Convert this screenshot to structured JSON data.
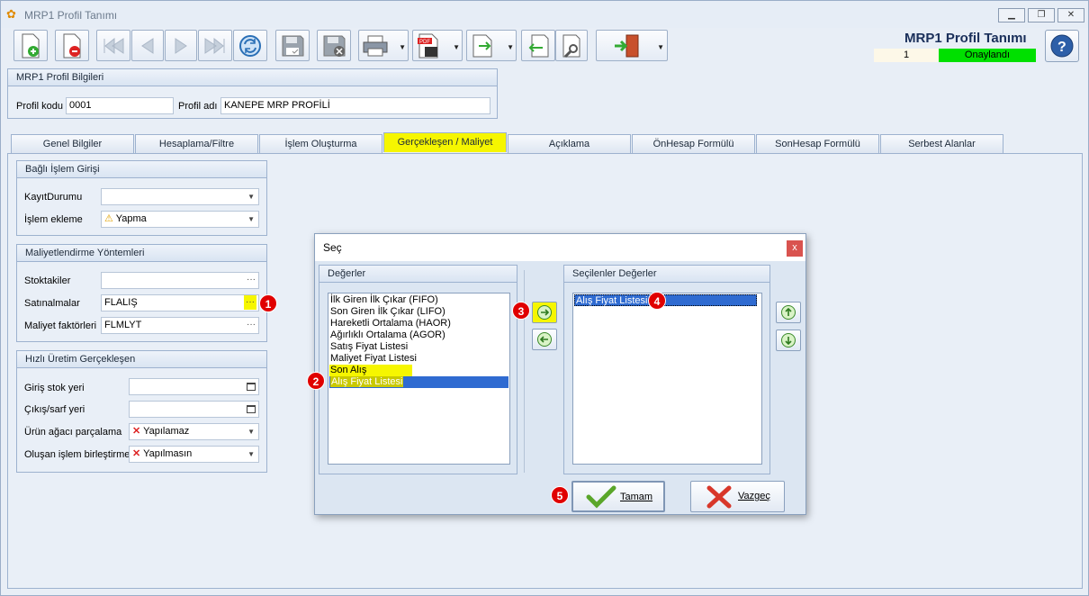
{
  "window": {
    "title": "MRP1 Profil Tanımı",
    "app_icon": "butterfly-icon",
    "controls": [
      "minimize-icon",
      "restore-icon",
      "close-icon"
    ]
  },
  "toolbar": {
    "buttons": [
      "new-doc-icon",
      "delete-doc-icon",
      "first-record-icon",
      "prev-record-icon",
      "next-record-icon",
      "last-record-icon",
      "refresh-icon",
      "save-icon",
      "save-close-icon",
      "print-icon",
      "pdf-icon",
      "export-icon",
      "import-icon",
      "settings-icon",
      "exit-icon"
    ]
  },
  "header": {
    "app_title": "MRP1 Profil Tanımı",
    "row_number": "1",
    "status": "Onaylandı",
    "status_color": "#00e000"
  },
  "profile": {
    "section_title": "MRP1 Profil Bilgileri",
    "code_label": "Profil kodu",
    "code_value": "0001",
    "name_label": "Profil adı",
    "name_value": "KANEPE MRP PROFİLİ"
  },
  "tabs": [
    "Genel Bilgiler",
    "Hesaplama/Filtre",
    "İşlem Oluşturma",
    "Gerçekleşen / Maliyet",
    "Açıklama",
    "ÖnHesap Formülü",
    "SonHesap Formülü",
    "Serbest Alanlar"
  ],
  "active_tab": "Gerçekleşen / Maliyet",
  "bagli": {
    "title": "Bağlı İşlem Girişi",
    "kayit_label": "KayıtDurumu",
    "kayit_value": "",
    "islem_label": "İşlem ekleme",
    "islem_value": "Yapma"
  },
  "maliyet": {
    "title": "Maliyetlendirme Yöntemleri",
    "stok_label": "Stoktakiler",
    "stok_value": "",
    "satin_label": "Satınalmalar",
    "satin_value": "FLALIŞ",
    "faktor_label": "Maliyet faktörleri",
    "faktor_value": "FLMLYT"
  },
  "hizli": {
    "title": "Hızlı Üretim Gerçekleşen",
    "giris_label": "Giriş stok yeri",
    "giris_value": "",
    "cikis_label": "Çıkış/sarf yeri",
    "cikis_value": "",
    "agac_label": "Ürün ağacı parçalama",
    "agac_value": "Yapılamaz",
    "birles_label": "Oluşan işlem birleştirme",
    "birles_value": "Yapılmasın"
  },
  "dialog": {
    "title": "Seç",
    "close": "x",
    "left_title": "Değerler",
    "left_items": [
      "İlk Giren İlk Çıkar (FIFO)",
      "Son Giren İlk Çıkar (LIFO)",
      "Hareketli Ortalama (HAOR)",
      "Ağırlıklı Ortalama (AGOR)",
      "Satış Fiyat Listesi",
      "Maliyet Fiyat Listesi",
      "Son Alış",
      "Alış Fiyat Listesi"
    ],
    "right_title": "Seçilenler Değerler",
    "right_items": [
      "Alış Fiyat Listesi"
    ],
    "ok_label": "Tamam",
    "cancel_label": "Vazgeç"
  },
  "badges": [
    "1",
    "2",
    "3",
    "4",
    "5"
  ],
  "colors": {
    "highlight": "#f6f600",
    "selected": "#2f6bd1",
    "badge": "#e00000"
  }
}
